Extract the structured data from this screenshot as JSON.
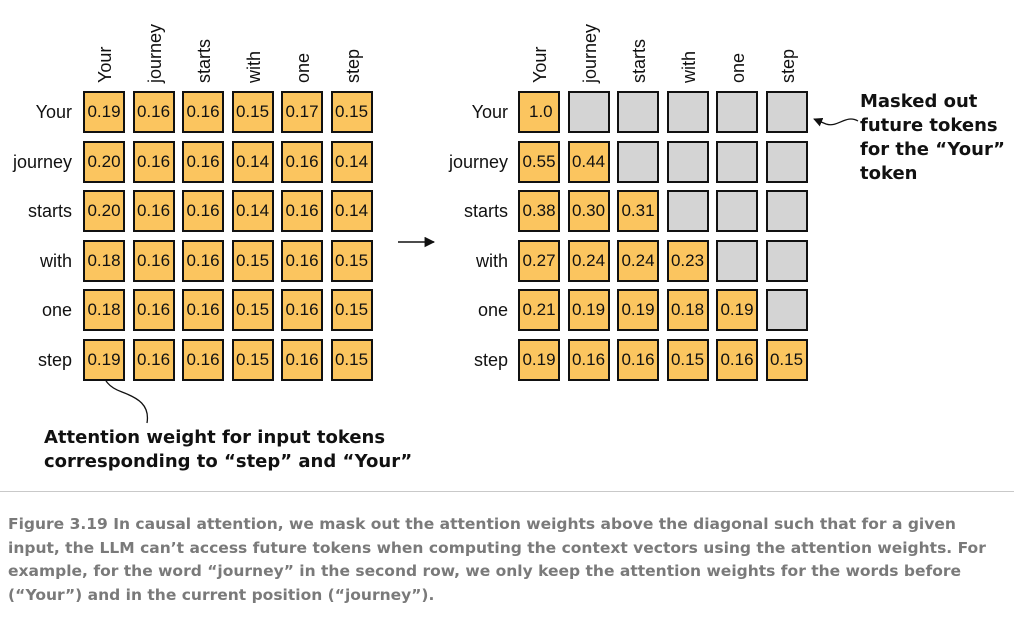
{
  "tokens": [
    "Your",
    "journey",
    "starts",
    "with",
    "one",
    "step"
  ],
  "left_matrix": [
    [
      "0.19",
      "0.16",
      "0.16",
      "0.15",
      "0.17",
      "0.15"
    ],
    [
      "0.20",
      "0.16",
      "0.16",
      "0.14",
      "0.16",
      "0.14"
    ],
    [
      "0.20",
      "0.16",
      "0.16",
      "0.14",
      "0.16",
      "0.14"
    ],
    [
      "0.18",
      "0.16",
      "0.16",
      "0.15",
      "0.16",
      "0.15"
    ],
    [
      "0.18",
      "0.16",
      "0.16",
      "0.15",
      "0.16",
      "0.15"
    ],
    [
      "0.19",
      "0.16",
      "0.16",
      "0.15",
      "0.16",
      "0.15"
    ]
  ],
  "right_matrix": [
    [
      "1.0",
      "",
      "",
      "",
      "",
      ""
    ],
    [
      "0.55",
      "0.44",
      "",
      "",
      "",
      ""
    ],
    [
      "0.38",
      "0.30",
      "0.31",
      "",
      "",
      ""
    ],
    [
      "0.27",
      "0.24",
      "0.24",
      "0.23",
      "",
      ""
    ],
    [
      "0.21",
      "0.19",
      "0.19",
      "0.18",
      "0.19",
      ""
    ],
    [
      "0.19",
      "0.16",
      "0.16",
      "0.15",
      "0.16",
      "0.15"
    ]
  ],
  "colors": {
    "cell": "#fbc55f",
    "masked": "#d4d4d4",
    "border": "#111111",
    "caption": "#7a7a7a"
  },
  "callouts": {
    "masked": [
      "Masked out",
      "future tokens",
      "for the “Your”",
      "token"
    ],
    "attention": [
      "Attention weight for input tokens",
      "corresponding to “step” and “Your”"
    ]
  },
  "caption": "Figure 3.19 In causal attention, we mask out the attention weights above the diagonal such that for a given input, the LLM can’t access future tokens when computing the context vectors using the attention weights. For example, for the word “journey” in the second row, we only keep the attention weights for the words before (“Your”) and in the current position (“journey”)."
}
